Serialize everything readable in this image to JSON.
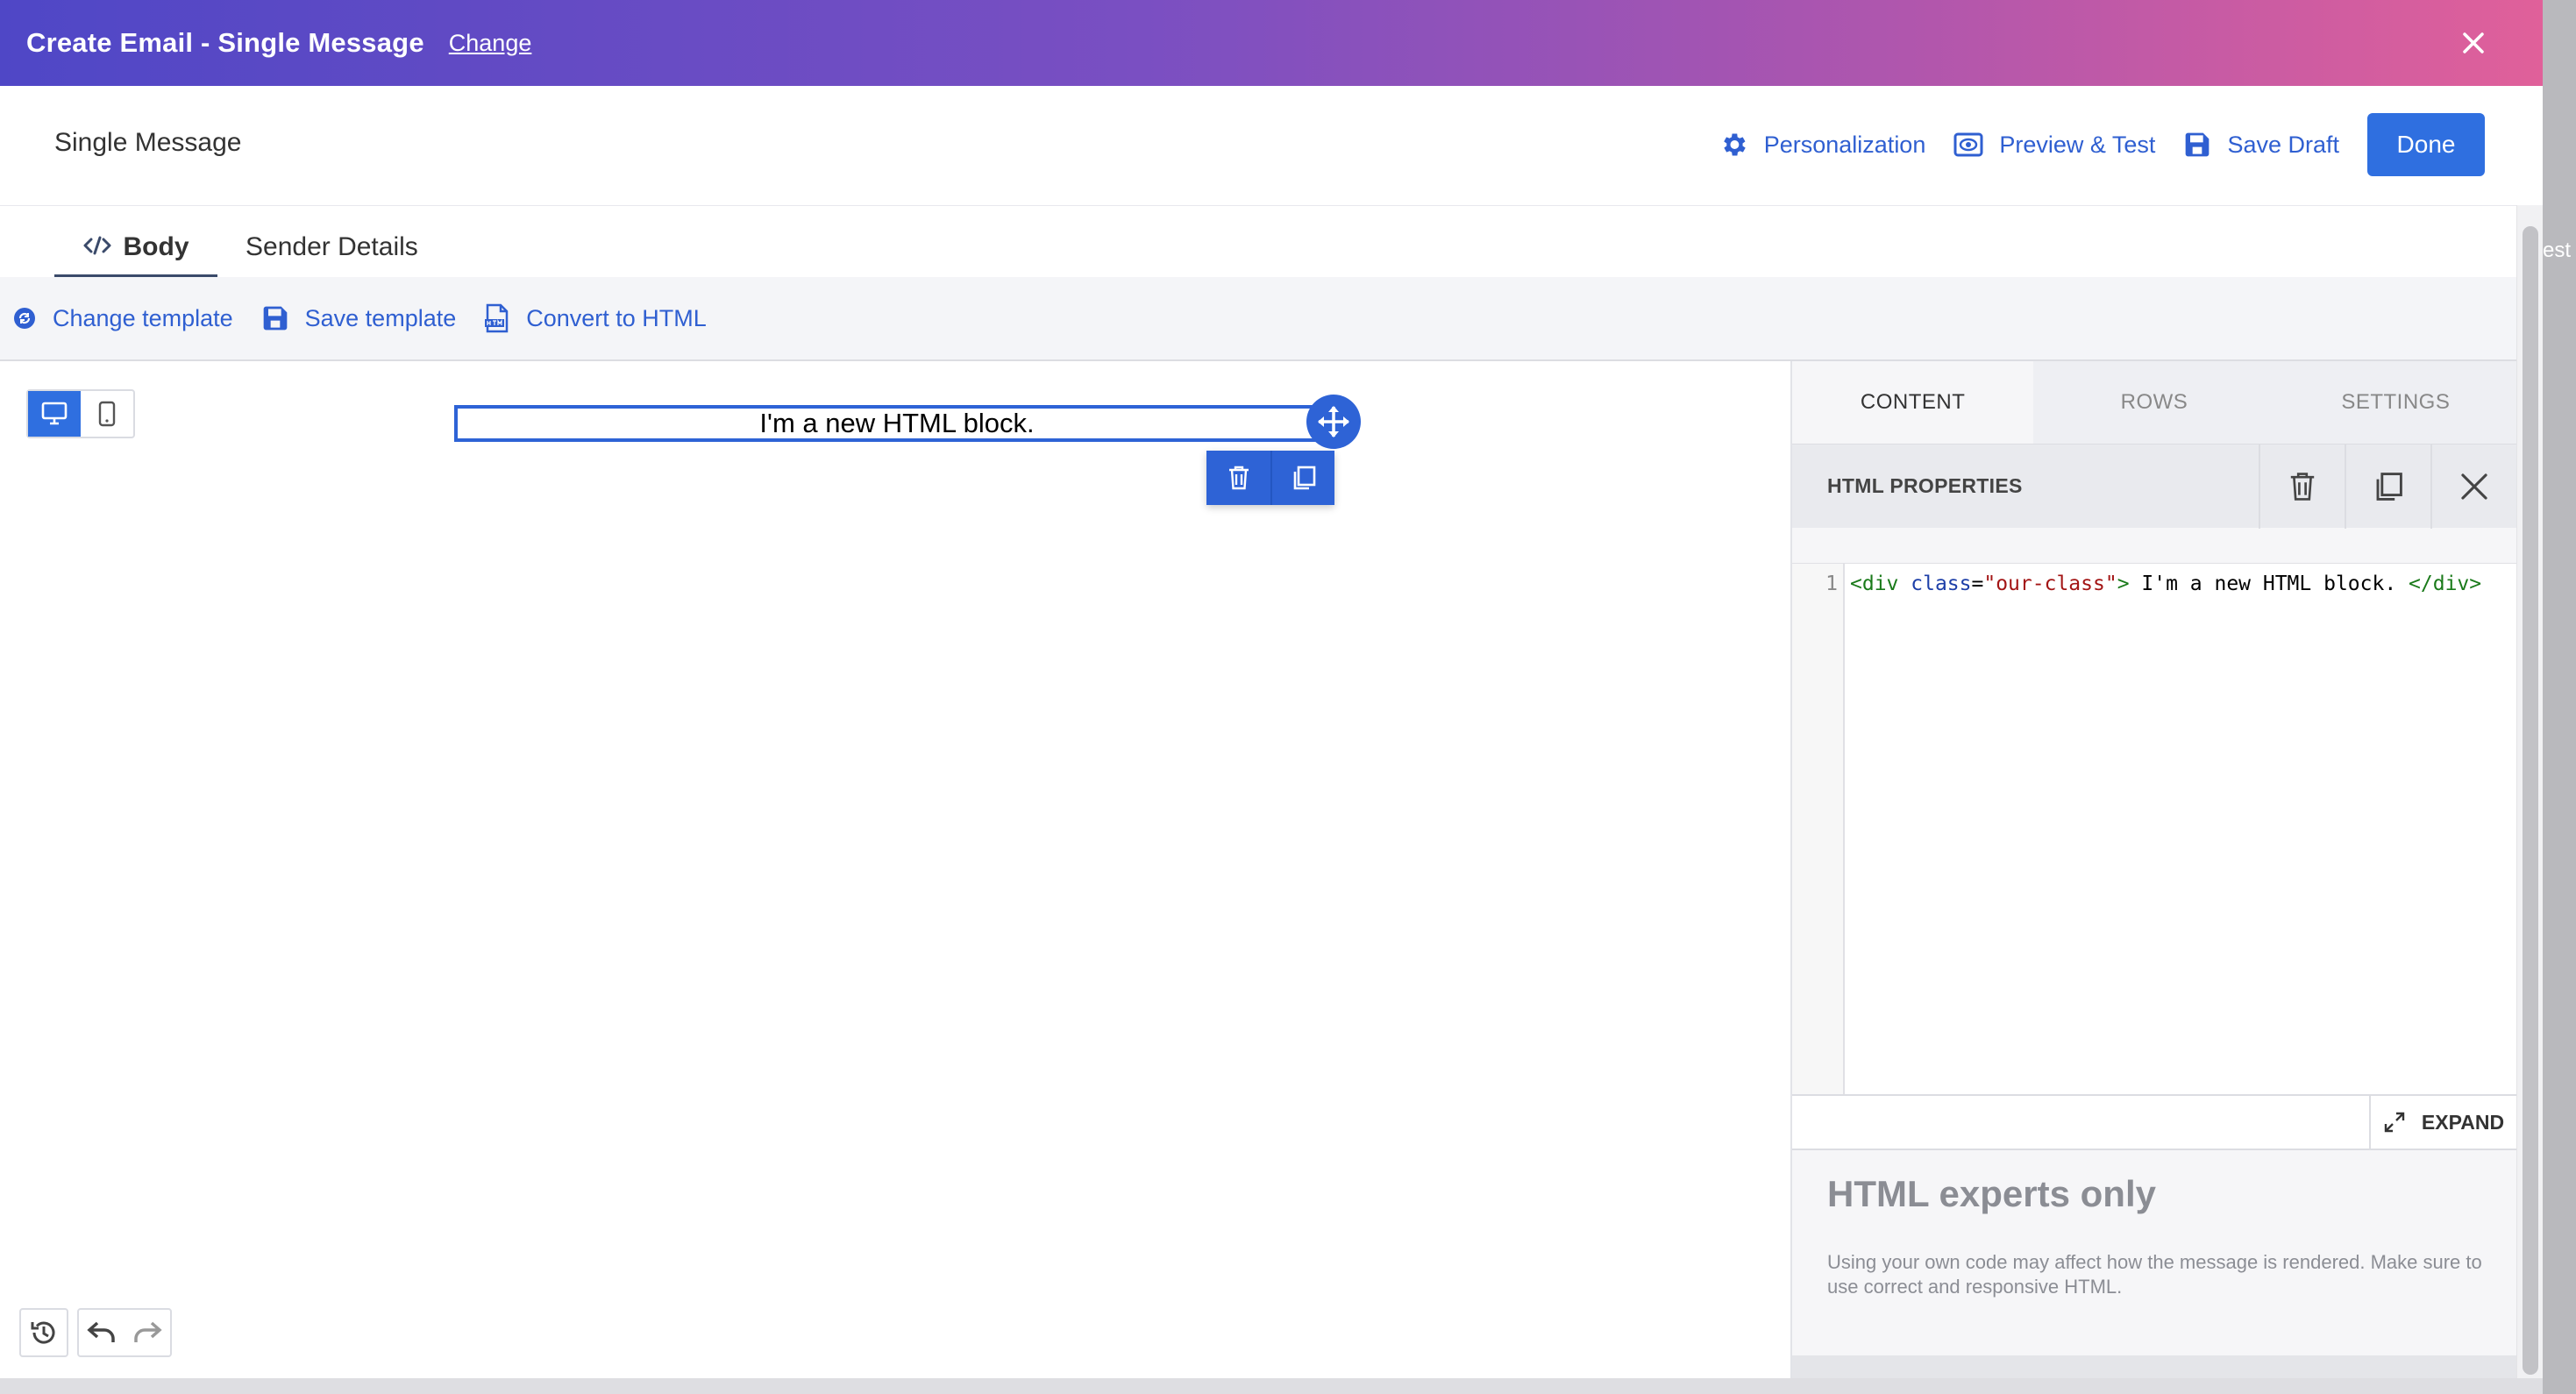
{
  "window": {
    "title": "Create Email - Single Message",
    "change_link": "Change"
  },
  "header": {
    "page_title": "Single Message",
    "personalization": "Personalization",
    "preview_test": "Preview & Test",
    "save_draft": "Save Draft",
    "done": "Done"
  },
  "tabs": {
    "body": "Body",
    "sender_details": "Sender Details"
  },
  "toolbar": {
    "change_template": "Change template",
    "save_template": "Save template",
    "convert_html": "Convert to HTML"
  },
  "canvas": {
    "block_text": "I'm a new HTML block."
  },
  "panel": {
    "tabs": [
      "CONTENT",
      "ROWS",
      "SETTINGS"
    ],
    "properties_title": "HTML PROPERTIES",
    "line_number": "1",
    "code": {
      "open_tag": "<div",
      "attr": "class",
      "eq": "=",
      "value": "\"our-class\"",
      "close_open": ">",
      "text": " I'm a new HTML block. ",
      "close_tag": "</div>"
    },
    "expand": "EXPAND",
    "note_heading": "HTML experts only",
    "note_text": "Using your own code may affect how the message is rendered. Make sure to use correct and responsive HTML."
  },
  "background_text": "est",
  "colors": {
    "accent": "#2f6fe0",
    "link": "#2f5fd1",
    "gradient_start": "#4f47c6",
    "gradient_end": "#e0609a"
  }
}
